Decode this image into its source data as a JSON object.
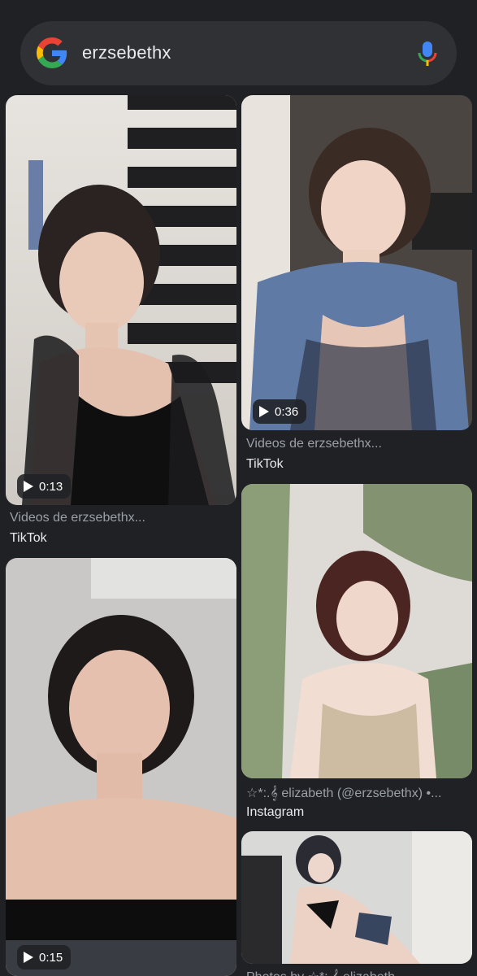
{
  "search": {
    "query": "erzsebethx"
  },
  "results": [
    {
      "duration": "0:13",
      "caption": "Videos de erzsebethx...",
      "source": "TikTok"
    },
    {
      "duration": "0:36",
      "caption": "Videos de erzsebethx...",
      "source": "TikTok"
    },
    {
      "duration": "0:15"
    },
    {
      "caption": "☆*:.𝄞 elizabeth (@erzsebethx) •...",
      "source": "Instagram"
    },
    {
      "caption": "Photos by ☆*:.𝄞 elizabeth"
    }
  ],
  "icons": {
    "logo": "google-g-icon",
    "mic": "microphone-icon",
    "play": "play-icon"
  },
  "colors": {
    "background": "#202124",
    "searchbar": "#303134",
    "caption": "#9aa0a6",
    "source": "#e8eaed"
  }
}
